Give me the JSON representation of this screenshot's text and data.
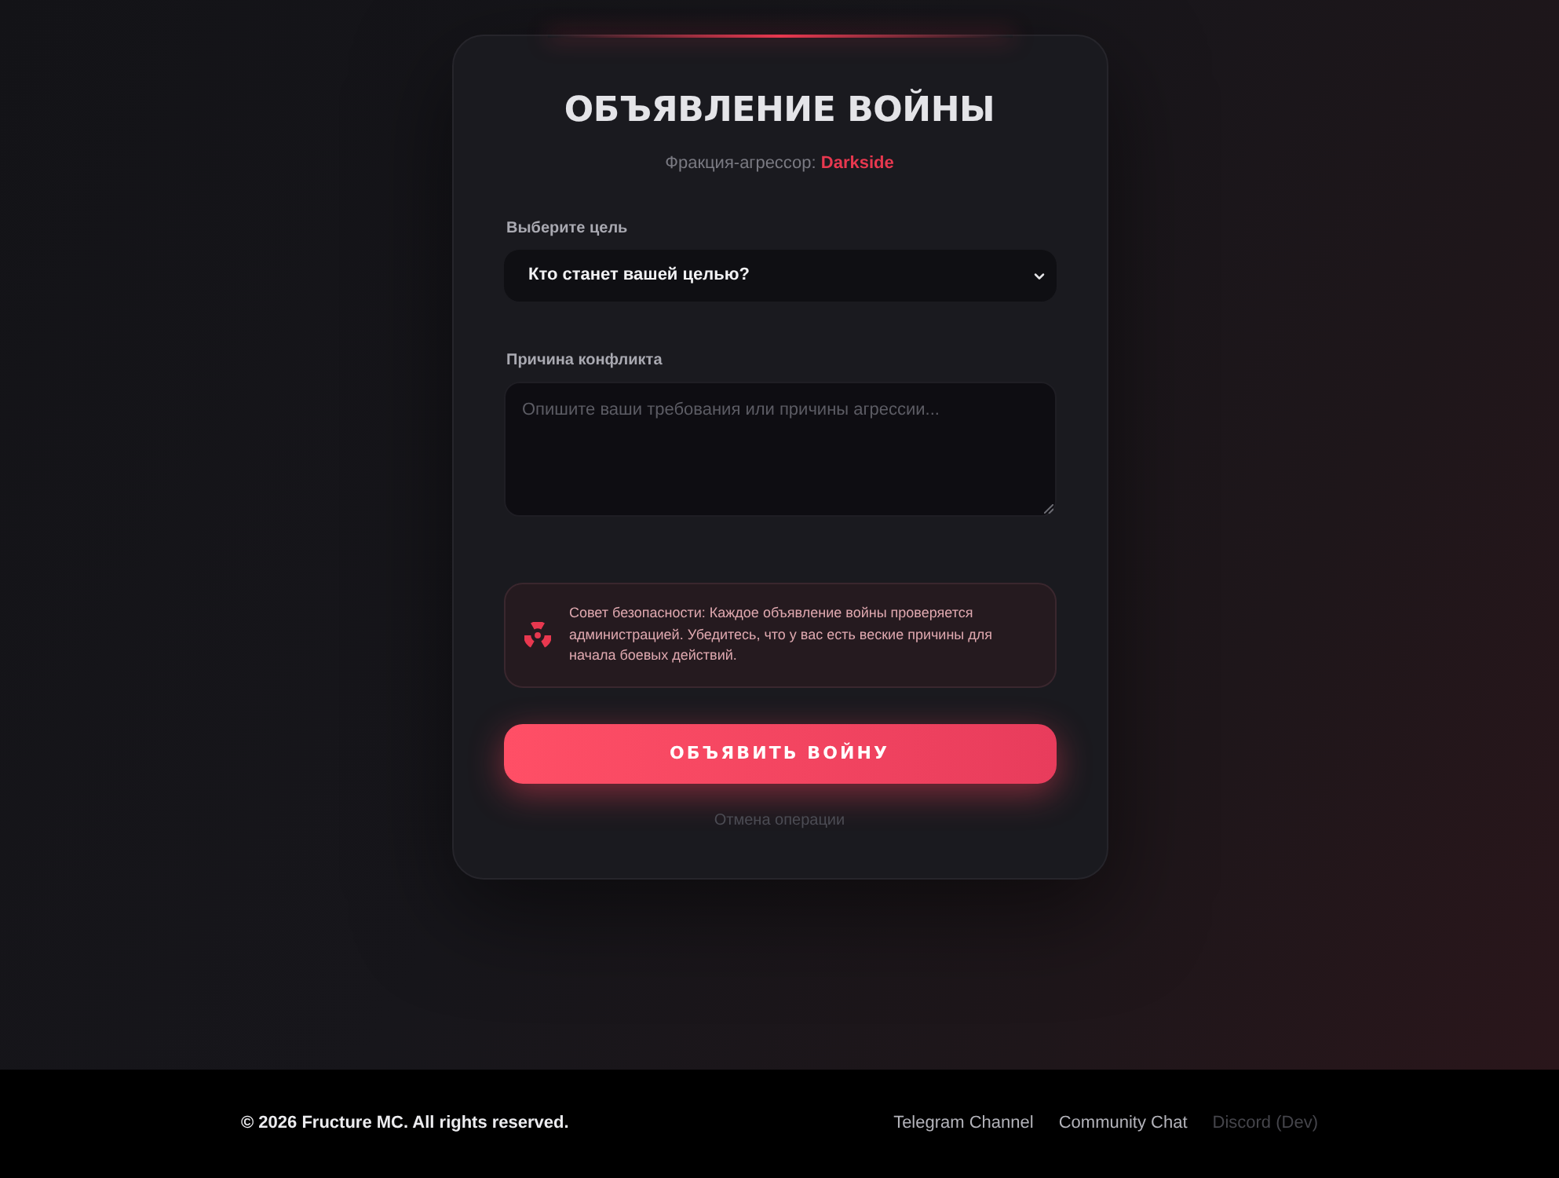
{
  "card": {
    "title": "ОБЪЯВЛЕНИЕ ВОЙНЫ",
    "subtitle": "Фракция-агрессор: **Darkside**",
    "fields": [
      {
        "kind": "select",
        "label": "Выберите цель",
        "value": "Кто станет вашей целью?"
      },
      {
        "kind": "textarea",
        "label": "Причина конфликта",
        "placeholder": "Опишите ваши требования или причины агрессии..."
      }
    ],
    "notice": {
      "text": "Совет безопасности: Каждое объявление войны проверяется администрацией. Убедитесь, что у вас есть веские причины для начала боевых действий."
    },
    "submit_button": "ОБЪЯВИТЬ ВОЙНУ",
    "cancel_link": "Отмена операции"
  },
  "footer": {
    "copyright": "© 2026 Fructure MC. All rights reserved.",
    "links": [
      {
        "label": "Telegram Channel",
        "disabled": false
      },
      {
        "label": "Community Chat",
        "disabled": false
      },
      {
        "label": "Discord (Dev)",
        "disabled": true
      }
    ]
  }
}
